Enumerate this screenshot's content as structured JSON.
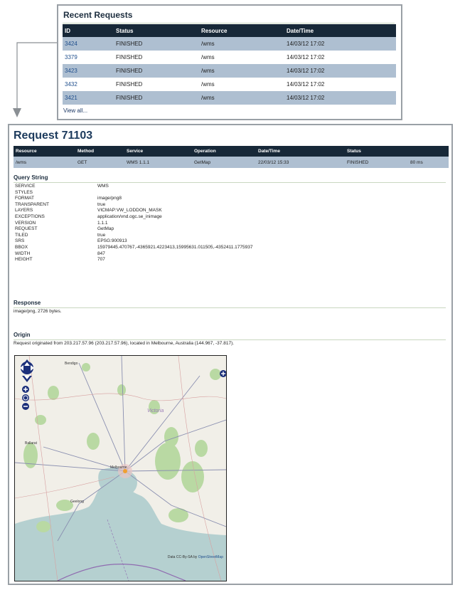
{
  "recent": {
    "title": "Recent Requests",
    "columns": [
      "ID",
      "Status",
      "Resource",
      "Date/Time"
    ],
    "rows": [
      {
        "id": "3424",
        "status": "FINISHED",
        "resource": "/wms",
        "datetime": "14/03/12 17:02"
      },
      {
        "id": "3379",
        "status": "FINISHED",
        "resource": "/wms",
        "datetime": "14/03/12 17:02"
      },
      {
        "id": "3423",
        "status": "FINISHED",
        "resource": "/wms",
        "datetime": "14/03/12 17:02"
      },
      {
        "id": "3432",
        "status": "FINISHED",
        "resource": "/wms",
        "datetime": "14/03/12 17:02"
      },
      {
        "id": "3421",
        "status": "FINISHED",
        "resource": "/wms",
        "datetime": "14/03/12 17:02"
      }
    ],
    "view_all": "View all..."
  },
  "request": {
    "title": "Request 71103",
    "columns": [
      "Resource",
      "Method",
      "Service",
      "Operation",
      "Date/Time",
      "Status",
      ""
    ],
    "values": [
      "/wms",
      "GET",
      "WMS 1.1.1",
      "GetMap",
      "22/03/12 15:33",
      "FINISHED",
      "80 ms"
    ]
  },
  "query_string": {
    "title": "Query String",
    "params": [
      {
        "key": "SERVICE",
        "value": "WMS"
      },
      {
        "key": "STYLES",
        "value": ""
      },
      {
        "key": "FORMAT",
        "value": "image/png8"
      },
      {
        "key": "TRANSPARENT",
        "value": "true"
      },
      {
        "key": "LAYERS",
        "value": "VICMAP:VW_LODDON_MASK"
      },
      {
        "key": "EXCEPTIONS",
        "value": "application/vnd.ogc.se_inimage"
      },
      {
        "key": "VERSION",
        "value": "1.1.1"
      },
      {
        "key": "REQUEST",
        "value": "GetMap"
      },
      {
        "key": "TILED",
        "value": "true"
      },
      {
        "key": "SRS",
        "value": "EPSG:900913"
      },
      {
        "key": "BBOX",
        "value": "15979445.470767,-4365921.4223413,15995631.011505,-4352411.1775937"
      },
      {
        "key": "WIDTH",
        "value": "847"
      },
      {
        "key": "HEIGHT",
        "value": "707"
      }
    ]
  },
  "response": {
    "title": "Response",
    "text": "image/png, 2726 bytes."
  },
  "origin": {
    "title": "Origin",
    "text": "Request originated from 203.217.57.96 (203.217.57.96), located in Melbourne, Australia (144.967, -37.817)."
  },
  "map": {
    "labels": {
      "bendigo": "Bendigo",
      "victoria": "Victoria",
      "ballarat": "Ballarat",
      "melbourne": "Melbourne",
      "geelong": "Geelong"
    },
    "credit_prefix": "Data CC-By-SA by ",
    "credit_link": "OpenStreetMap",
    "colors": {
      "land": "#f1efe8",
      "water": "#b5d0d0",
      "forest": "#b9d9a3",
      "roads": "#8a8fb0"
    }
  }
}
